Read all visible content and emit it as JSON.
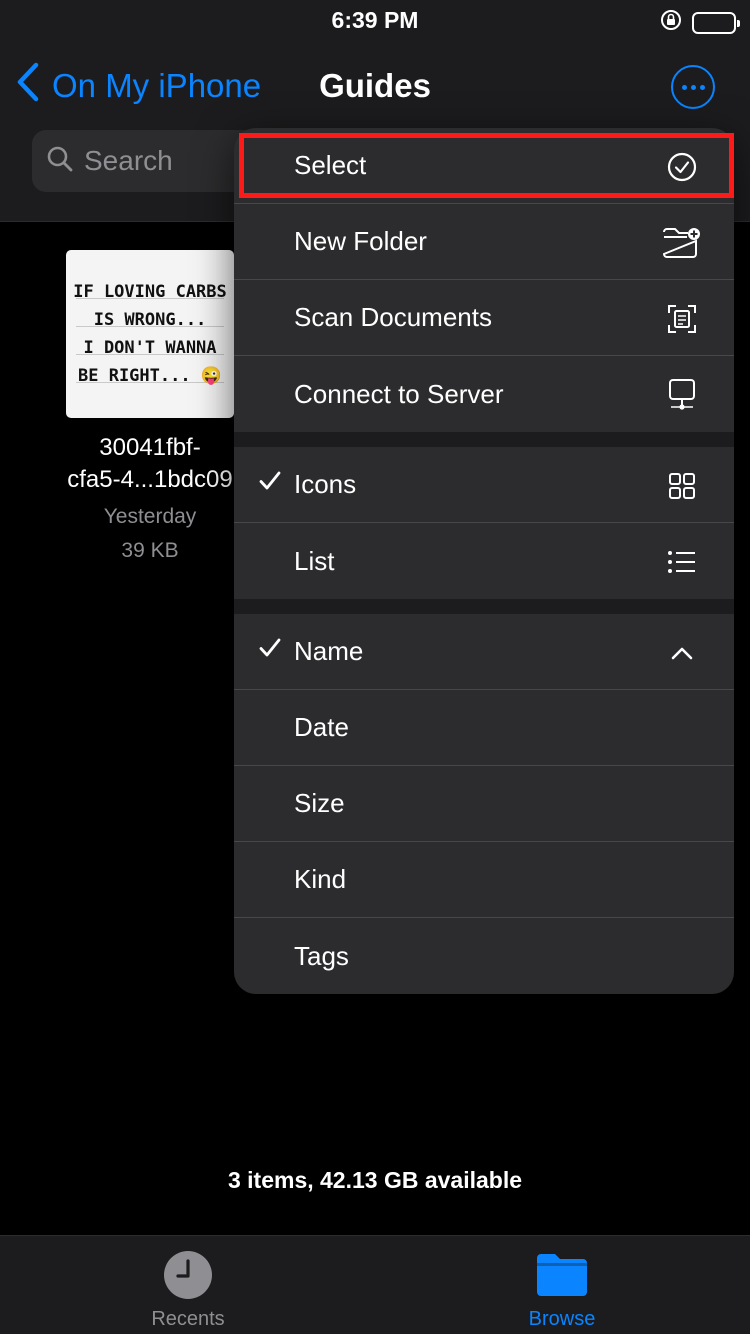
{
  "status_bar": {
    "time": "6:39 PM"
  },
  "nav": {
    "back_label": "On My iPhone",
    "title": "Guides",
    "search_placeholder": "Search"
  },
  "file": {
    "thumbnail_lines": [
      "IF LOVING CARBS",
      "IS WRONG...",
      "I DON'T WANNA",
      "BE RIGHT... 😜"
    ],
    "name_line1": "30041fbf-",
    "name_line2": "cfa5-4...1bdc09",
    "date": "Yesterday",
    "size": "39 KB"
  },
  "menu": {
    "actions": [
      {
        "label": "Select",
        "icon": "checkmark-circle-icon"
      },
      {
        "label": "New Folder",
        "icon": "folder-add-icon"
      },
      {
        "label": "Scan Documents",
        "icon": "scan-document-icon"
      },
      {
        "label": "Connect to Server",
        "icon": "server-icon"
      }
    ],
    "views": [
      {
        "label": "Icons",
        "checked": true,
        "icon": "grid-icon"
      },
      {
        "label": "List",
        "checked": false,
        "icon": "list-icon"
      }
    ],
    "sort": [
      {
        "label": "Name",
        "checked": true,
        "icon": "chevron-up-icon"
      },
      {
        "label": "Date",
        "checked": false
      },
      {
        "label": "Size",
        "checked": false
      },
      {
        "label": "Kind",
        "checked": false
      },
      {
        "label": "Tags",
        "checked": false
      }
    ]
  },
  "storage_info": "3 items, 42.13 GB available",
  "tabs": [
    {
      "label": "Recents",
      "icon": "clock-icon",
      "active": false
    },
    {
      "label": "Browse",
      "icon": "folder-icon",
      "active": true
    }
  ],
  "colors": {
    "accent": "#0a84ff",
    "highlight": "#ff1a1a",
    "menu_bg": "#2c2c2e",
    "bar_bg": "#1c1c1e"
  }
}
